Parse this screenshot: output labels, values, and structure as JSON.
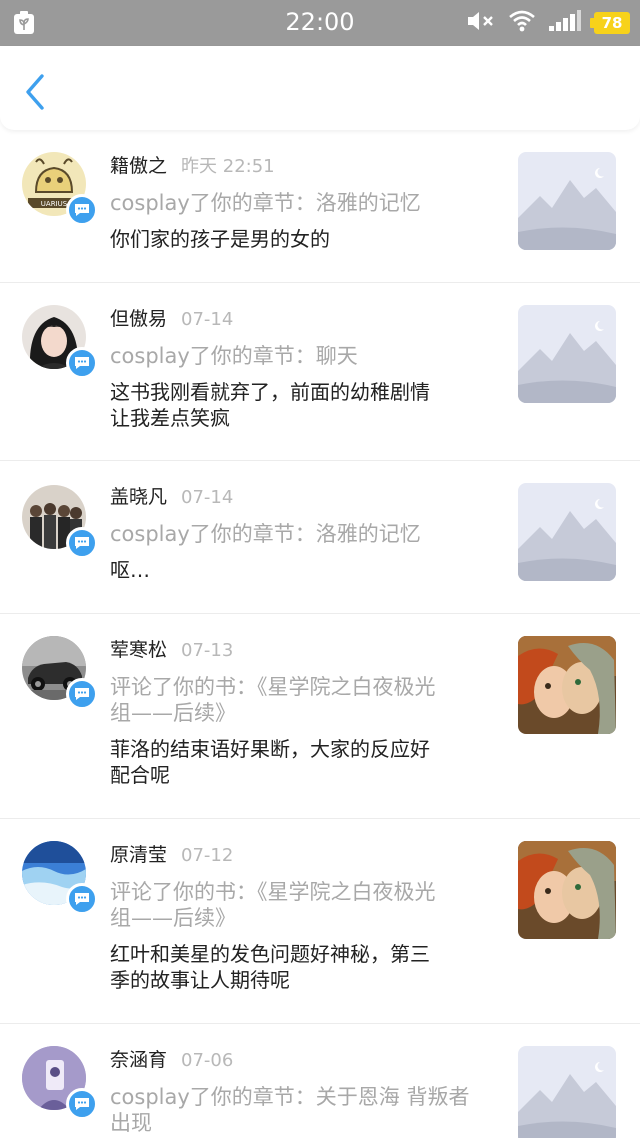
{
  "status_bar": {
    "time": "22:00",
    "battery": "78",
    "icons": [
      "app-notification-icon",
      "mute-icon",
      "wifi-icon",
      "signal-icon",
      "battery-icon"
    ]
  },
  "header": {
    "back_icon": "chevron-left-icon"
  },
  "items": [
    {
      "name": "籍傲之",
      "time": "昨天 22:51",
      "action": "cosplay了你的章节：洛雅的记忆",
      "comment": "你们家的孩子是男的女的",
      "thumb": "placeholder",
      "avatar": "logo"
    },
    {
      "name": "但傲易",
      "time": "07-14",
      "action": "cosplay了你的章节：聊天",
      "comment": "这书我刚看就弃了，前面的幼稚剧情\n让我差点笑疯",
      "thumb": "placeholder",
      "avatar": "girl"
    },
    {
      "name": "盖晓凡",
      "time": "07-14",
      "action": "cosplay了你的章节：洛雅的记忆",
      "comment": "呕…",
      "thumb": "placeholder",
      "avatar": "group"
    },
    {
      "name": "荤寒松",
      "time": "07-13",
      "action": "评论了你的书：《星学院之白夜极光\n组——后续》",
      "comment": "菲洛的结束语好果断，大家的反应好\n配合呢",
      "thumb": "book",
      "avatar": "car"
    },
    {
      "name": "原清莹",
      "time": "07-12",
      "action": "评论了你的书：《星学院之白夜极光\n组——后续》",
      "comment": "红叶和美星的发色问题好神秘，第三\n季的故事让人期待呢",
      "thumb": "book",
      "avatar": "sky"
    },
    {
      "name": "奈涵育",
      "time": "07-06",
      "action": "cosplay了你的章节：关于恩海 背叛者\n出现",
      "comment": "",
      "thumb": "placeholder",
      "avatar": "purple"
    }
  ],
  "colors": {
    "status_bar": "#9a9a9a",
    "accent": "#3ea0ee",
    "battery": "#f7d21a",
    "muted_text": "#a8a8a8"
  }
}
